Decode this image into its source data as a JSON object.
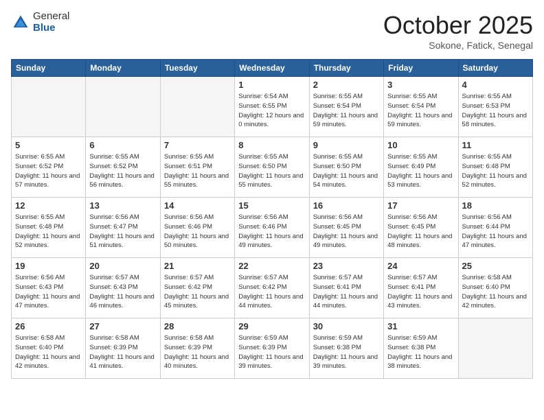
{
  "header": {
    "logo_general": "General",
    "logo_blue": "Blue",
    "month": "October 2025",
    "location": "Sokone, Fatick, Senegal"
  },
  "days_of_week": [
    "Sunday",
    "Monday",
    "Tuesday",
    "Wednesday",
    "Thursday",
    "Friday",
    "Saturday"
  ],
  "weeks": [
    [
      {
        "num": "",
        "empty": true
      },
      {
        "num": "",
        "empty": true
      },
      {
        "num": "",
        "empty": true
      },
      {
        "num": "1",
        "sunrise": "6:54 AM",
        "sunset": "6:55 PM",
        "daylight": "12 hours and 0 minutes."
      },
      {
        "num": "2",
        "sunrise": "6:55 AM",
        "sunset": "6:54 PM",
        "daylight": "11 hours and 59 minutes."
      },
      {
        "num": "3",
        "sunrise": "6:55 AM",
        "sunset": "6:54 PM",
        "daylight": "11 hours and 59 minutes."
      },
      {
        "num": "4",
        "sunrise": "6:55 AM",
        "sunset": "6:53 PM",
        "daylight": "11 hours and 58 minutes."
      }
    ],
    [
      {
        "num": "5",
        "sunrise": "6:55 AM",
        "sunset": "6:52 PM",
        "daylight": "11 hours and 57 minutes."
      },
      {
        "num": "6",
        "sunrise": "6:55 AM",
        "sunset": "6:52 PM",
        "daylight": "11 hours and 56 minutes."
      },
      {
        "num": "7",
        "sunrise": "6:55 AM",
        "sunset": "6:51 PM",
        "daylight": "11 hours and 55 minutes."
      },
      {
        "num": "8",
        "sunrise": "6:55 AM",
        "sunset": "6:50 PM",
        "daylight": "11 hours and 55 minutes."
      },
      {
        "num": "9",
        "sunrise": "6:55 AM",
        "sunset": "6:50 PM",
        "daylight": "11 hours and 54 minutes."
      },
      {
        "num": "10",
        "sunrise": "6:55 AM",
        "sunset": "6:49 PM",
        "daylight": "11 hours and 53 minutes."
      },
      {
        "num": "11",
        "sunrise": "6:55 AM",
        "sunset": "6:48 PM",
        "daylight": "11 hours and 52 minutes."
      }
    ],
    [
      {
        "num": "12",
        "sunrise": "6:55 AM",
        "sunset": "6:48 PM",
        "daylight": "11 hours and 52 minutes."
      },
      {
        "num": "13",
        "sunrise": "6:56 AM",
        "sunset": "6:47 PM",
        "daylight": "11 hours and 51 minutes."
      },
      {
        "num": "14",
        "sunrise": "6:56 AM",
        "sunset": "6:46 PM",
        "daylight": "11 hours and 50 minutes."
      },
      {
        "num": "15",
        "sunrise": "6:56 AM",
        "sunset": "6:46 PM",
        "daylight": "11 hours and 49 minutes."
      },
      {
        "num": "16",
        "sunrise": "6:56 AM",
        "sunset": "6:45 PM",
        "daylight": "11 hours and 49 minutes."
      },
      {
        "num": "17",
        "sunrise": "6:56 AM",
        "sunset": "6:45 PM",
        "daylight": "11 hours and 48 minutes."
      },
      {
        "num": "18",
        "sunrise": "6:56 AM",
        "sunset": "6:44 PM",
        "daylight": "11 hours and 47 minutes."
      }
    ],
    [
      {
        "num": "19",
        "sunrise": "6:56 AM",
        "sunset": "6:43 PM",
        "daylight": "11 hours and 47 minutes."
      },
      {
        "num": "20",
        "sunrise": "6:57 AM",
        "sunset": "6:43 PM",
        "daylight": "11 hours and 46 minutes."
      },
      {
        "num": "21",
        "sunrise": "6:57 AM",
        "sunset": "6:42 PM",
        "daylight": "11 hours and 45 minutes."
      },
      {
        "num": "22",
        "sunrise": "6:57 AM",
        "sunset": "6:42 PM",
        "daylight": "11 hours and 44 minutes."
      },
      {
        "num": "23",
        "sunrise": "6:57 AM",
        "sunset": "6:41 PM",
        "daylight": "11 hours and 44 minutes."
      },
      {
        "num": "24",
        "sunrise": "6:57 AM",
        "sunset": "6:41 PM",
        "daylight": "11 hours and 43 minutes."
      },
      {
        "num": "25",
        "sunrise": "6:58 AM",
        "sunset": "6:40 PM",
        "daylight": "11 hours and 42 minutes."
      }
    ],
    [
      {
        "num": "26",
        "sunrise": "6:58 AM",
        "sunset": "6:40 PM",
        "daylight": "11 hours and 42 minutes."
      },
      {
        "num": "27",
        "sunrise": "6:58 AM",
        "sunset": "6:39 PM",
        "daylight": "11 hours and 41 minutes."
      },
      {
        "num": "28",
        "sunrise": "6:58 AM",
        "sunset": "6:39 PM",
        "daylight": "11 hours and 40 minutes."
      },
      {
        "num": "29",
        "sunrise": "6:59 AM",
        "sunset": "6:39 PM",
        "daylight": "11 hours and 39 minutes."
      },
      {
        "num": "30",
        "sunrise": "6:59 AM",
        "sunset": "6:38 PM",
        "daylight": "11 hours and 39 minutes."
      },
      {
        "num": "31",
        "sunrise": "6:59 AM",
        "sunset": "6:38 PM",
        "daylight": "11 hours and 38 minutes."
      },
      {
        "num": "",
        "empty": true
      }
    ]
  ]
}
